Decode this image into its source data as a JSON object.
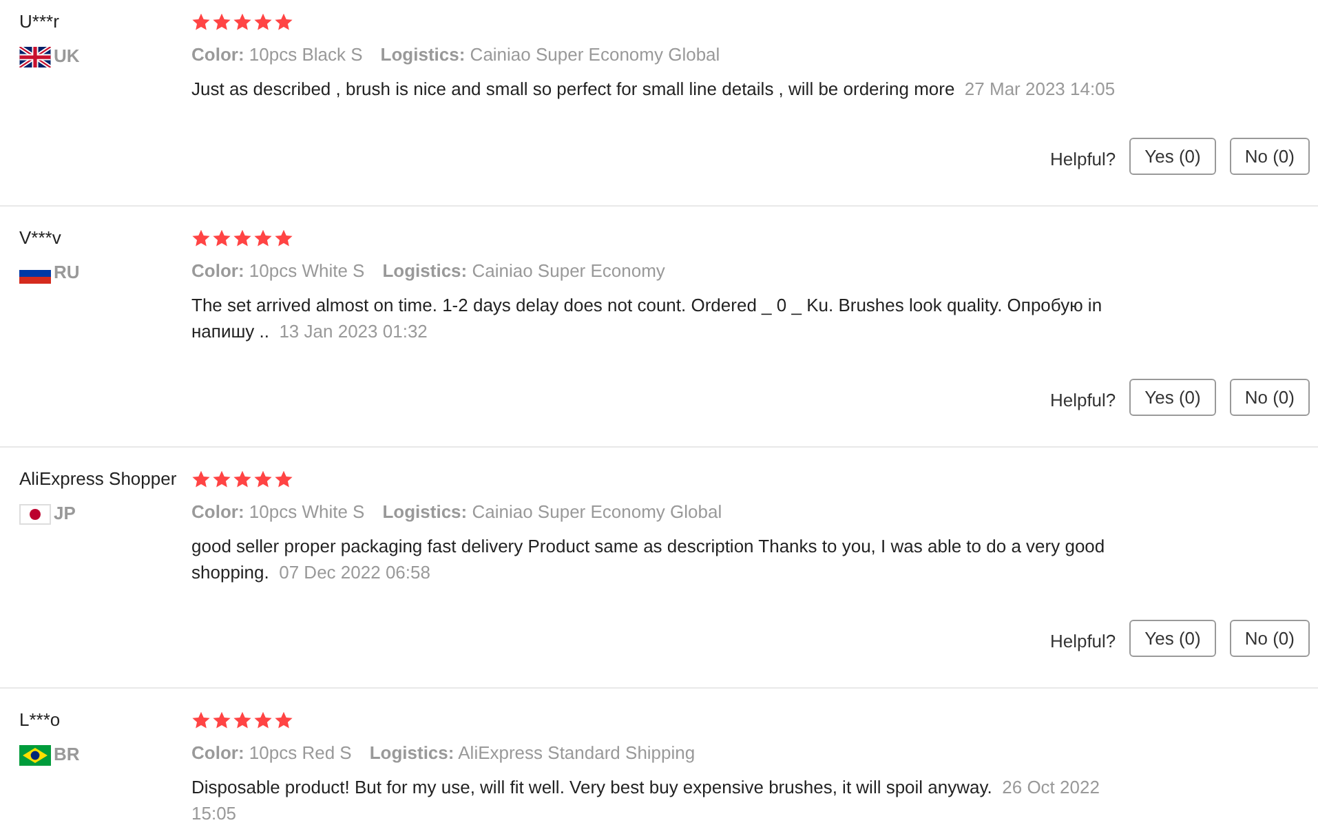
{
  "reviews": [
    {
      "reviewer": "U***r",
      "country": "UK",
      "kind": "uk",
      "stars": 5,
      "color_label": "Color:",
      "variant": "10pcs Black S",
      "logistics_label": "Logistics:",
      "logistics": "Cainiao Super Economy Global",
      "text": "Just as described , brush is nice and small so perfect for small line details , will be ordering more",
      "date": "27 Mar 2023 14:05",
      "helpful": "Helpful?",
      "yes": "Yes (0)",
      "no": "No (0)"
    },
    {
      "reviewer": "V***v",
      "country": "RU",
      "kind": "ru",
      "stars": 5,
      "color_label": "Color:",
      "variant": "10pcs White S",
      "logistics_label": "Logistics:",
      "logistics": "Cainiao Super Economy",
      "text": "The set arrived almost on time. 1-2 days delay does not count. Ordered _ 0 _ Ku. Brushes look quality. Опробую in напишу ..",
      "date": "13 Jan 2023 01:32",
      "helpful": "Helpful?",
      "yes": "Yes (0)",
      "no": "No (0)"
    },
    {
      "reviewer": "AliExpress Shopper",
      "country": "JP",
      "kind": "jp",
      "stars": 5,
      "color_label": "Color:",
      "variant": "10pcs White S",
      "logistics_label": "Logistics:",
      "logistics": "Cainiao Super Economy Global",
      "text": "good seller proper packaging fast delivery Product same as description Thanks to you, I was able to do a very good shopping.",
      "date": "07 Dec 2022 06:58",
      "helpful": "Helpful?",
      "yes": "Yes (0)",
      "no": "No (0)"
    },
    {
      "reviewer": "L***o",
      "country": "BR",
      "kind": "br",
      "stars": 5,
      "color_label": "Color:",
      "variant": "10pcs Red S",
      "logistics_label": "Logistics:",
      "logistics": "AliExpress Standard Shipping",
      "text": "Disposable product! But for my use, will fit well. Very best buy expensive brushes, it will spoil anyway.",
      "date": "26 Oct 2022 15:05"
    }
  ]
}
